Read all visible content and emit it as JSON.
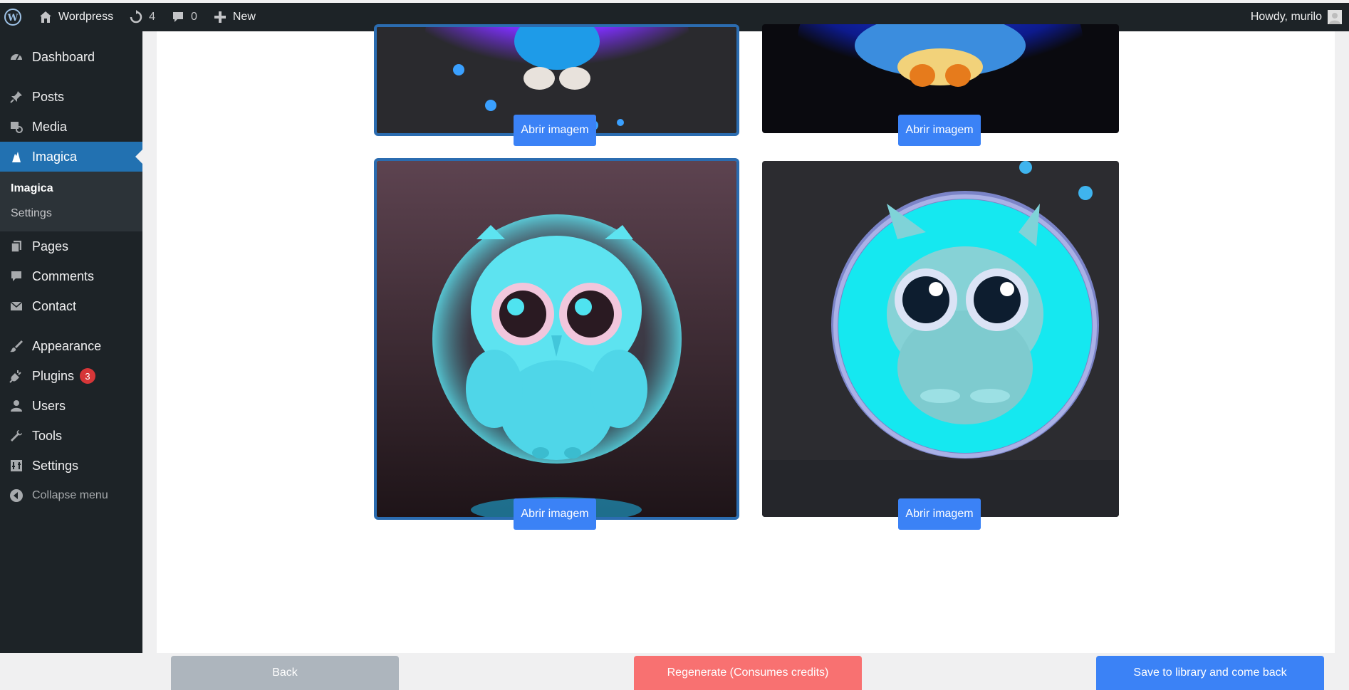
{
  "adminbar": {
    "site_name": "Wordpress",
    "updates_count": "4",
    "comments_count": "0",
    "new_label": "New",
    "howdy": "Howdy, murilo"
  },
  "sidebar": {
    "items": [
      {
        "label": "Dashboard",
        "icon": "dashboard-icon"
      },
      {
        "label": "Posts",
        "icon": "pin-icon"
      },
      {
        "label": "Media",
        "icon": "media-icon"
      },
      {
        "label": "Imagica",
        "icon": "imagica-icon"
      },
      {
        "label": "Pages",
        "icon": "pages-icon"
      },
      {
        "label": "Comments",
        "icon": "comment-icon"
      },
      {
        "label": "Contact",
        "icon": "mail-icon"
      },
      {
        "label": "Appearance",
        "icon": "brush-icon"
      },
      {
        "label": "Plugins",
        "icon": "plug-icon"
      },
      {
        "label": "Users",
        "icon": "user-icon"
      },
      {
        "label": "Tools",
        "icon": "wrench-icon"
      },
      {
        "label": "Settings",
        "icon": "settings-icon"
      }
    ],
    "submenu": [
      {
        "label": "Imagica"
      },
      {
        "label": "Settings"
      }
    ],
    "plugins_badge": "3",
    "collapse_label": "Collapse menu"
  },
  "gallery": {
    "open_label": "Abrir imagem"
  },
  "footer": {
    "back_label": "Back",
    "regenerate_label": "Regenerate (Consumes credits)",
    "save_label": "Save to library and come back"
  },
  "colors": {
    "accent": "#2271b1",
    "button_blue": "#3b82f6",
    "regenerate_red": "#f87171",
    "back_gray": "#adb5bd",
    "adminbar_bg": "#1d2327"
  }
}
